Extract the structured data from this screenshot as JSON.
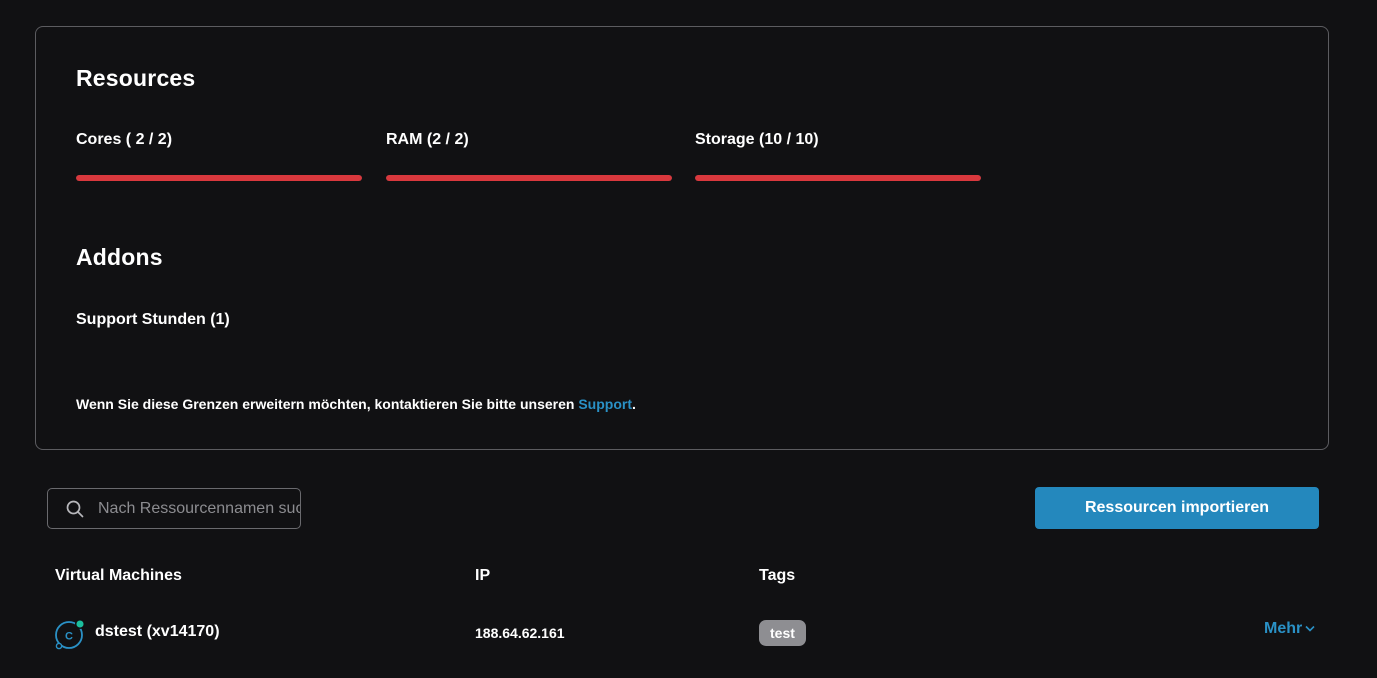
{
  "resources": {
    "title": "Resources",
    "items": [
      {
        "label": "Cores ( 2 / 2)",
        "used": 2,
        "total": 2
      },
      {
        "label": "RAM (2 / 2)",
        "used": 2,
        "total": 2
      },
      {
        "label": "Storage (10 / 10)",
        "used": 10,
        "total": 10
      }
    ],
    "bar_color": "#d9383d"
  },
  "addons": {
    "title": "Addons",
    "items": [
      {
        "label": "Support Stunden (1)"
      }
    ]
  },
  "notice": {
    "text": "Wenn Sie diese Grenzen erweitern möchten, kontaktieren Sie bitte unseren ",
    "link": "Support",
    "suffix": "."
  },
  "search": {
    "placeholder": "Nach Ressourcennamen suchen",
    "value": "",
    "icon": "search-icon"
  },
  "import_button": {
    "label": "Ressourcen importieren",
    "color": "#2488bd"
  },
  "table": {
    "columns": [
      "Virtual Machines",
      "IP",
      "Tags"
    ],
    "rows": [
      {
        "name": "dstest (xv14170)",
        "ip": "188.64.62.161",
        "tag": "test",
        "icon": "vm-icon",
        "icon_letter": "C",
        "status_color": "#1bbf9e",
        "more_label": "Mehr"
      }
    ]
  },
  "accent_color": "#2a91c6"
}
